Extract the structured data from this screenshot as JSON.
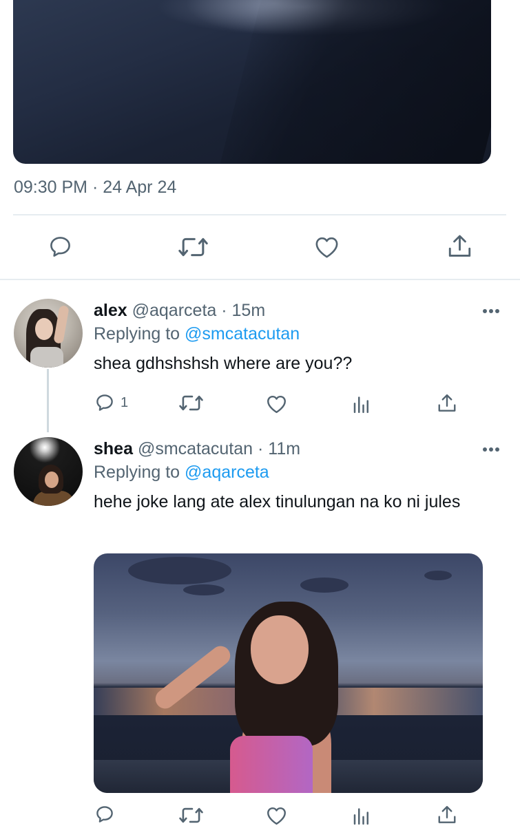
{
  "main_tweet": {
    "timestamp": "09:30 PM · 24 Apr 24",
    "photo": "night-ocean-photo",
    "actions": [
      "reply-icon",
      "retweet-icon",
      "like-icon",
      "share-icon"
    ]
  },
  "replies": [
    {
      "name": "alex",
      "handle": "@aqarceta",
      "time": "· 15m",
      "replying_label": "Replying to",
      "replying_to": "@smcatacutan",
      "text": "shea gdhshshsh where are you??",
      "reply_count": "1",
      "actions": [
        "reply-icon",
        "retweet-icon",
        "like-icon",
        "views-icon",
        "share-icon"
      ]
    },
    {
      "name": "shea",
      "handle": "@smcatacutan",
      "time": "· 11m",
      "replying_label": "Replying to",
      "replying_to": "@aqarceta",
      "text": "hehe joke lang ate alex tinulungan na ko ni jules",
      "photo": "beach-sunset-portrait-photo",
      "actions": [
        "reply-icon",
        "retweet-icon",
        "like-icon",
        "views-icon",
        "share-icon"
      ]
    }
  ],
  "colors": {
    "text": "#0f1419",
    "secondary": "#536471",
    "link": "#1d9bf0",
    "divider": "#e6ecf0"
  }
}
